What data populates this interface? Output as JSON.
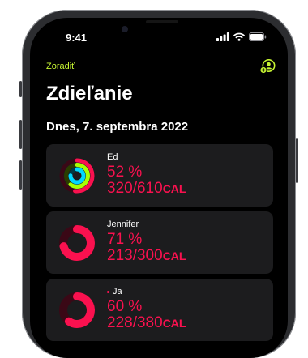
{
  "status": {
    "time": "9:41"
  },
  "nav": {
    "sort_label": "Zoradiť"
  },
  "header": {
    "title": "Zdieľanie"
  },
  "section": {
    "date_header": "Dnes, 7. septembra 2022"
  },
  "friends": [
    {
      "name": "Ed",
      "percent": "52 %",
      "calories": "320/610",
      "unit": "CAL",
      "move": 0.52,
      "exercise": 0.6,
      "stand": 0.75
    },
    {
      "name": "Jennifer",
      "percent": "71 %",
      "calories": "213/300",
      "unit": "CAL",
      "move": 0.71
    },
    {
      "name": "Ja",
      "percent": "60 %",
      "calories": "228/380",
      "unit": "CAL",
      "move": 0.6
    }
  ],
  "colors": {
    "move": "#fa114f",
    "exercise": "#a8ff04",
    "stand": "#00d8ff",
    "accent": "#c6f432"
  },
  "icons": {
    "add_friend": "person-plus-icon",
    "signal": "signal-icon",
    "wifi": "wifi-icon",
    "battery": "battery-icon"
  }
}
